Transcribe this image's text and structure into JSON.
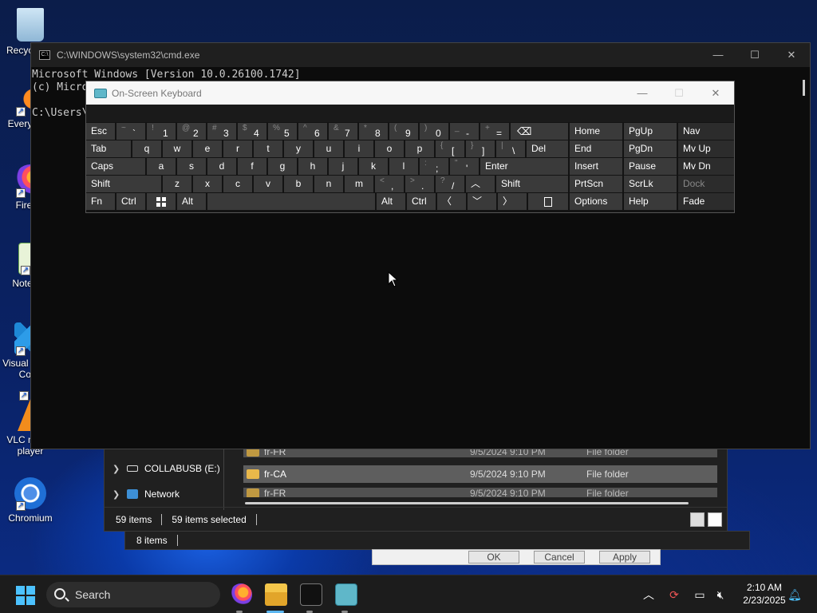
{
  "desktop": {
    "icons": [
      {
        "label": "Recycle Bin"
      },
      {
        "label": "Everything"
      },
      {
        "label": "Firefox"
      },
      {
        "label": "Notepad"
      },
      {
        "label": "Visual Studio Code"
      },
      {
        "label": "VLC media player"
      },
      {
        "label": "Chromium"
      }
    ]
  },
  "explorer": {
    "nav_items": [
      {
        "label": "COLLABUSB (E:)"
      },
      {
        "label": "Network"
      }
    ],
    "rows": [
      {
        "name": "fr-FR",
        "date": "9/5/2024 9:10 PM",
        "type": "File folder"
      },
      {
        "name": "fr-CA",
        "date": "9/5/2024 9:10 PM",
        "type": "File folder"
      },
      {
        "name": "fr-FR",
        "date": "9/5/2024 9:10 PM",
        "type": "File folder"
      }
    ],
    "status_count": "59 items",
    "status_selected": "59 items selected"
  },
  "explorer2": {
    "status_count": "8 items"
  },
  "dialog": {
    "ok": "OK",
    "cancel": "Cancel",
    "apply": "Apply"
  },
  "cmd": {
    "title": "C:\\WINDOWS\\system32\\cmd.exe",
    "line1": "Microsoft Windows [Version 10.0.26100.1742]",
    "line2": "(c) Micro",
    "line3": "C:\\Users\\"
  },
  "osk": {
    "title": "On-Screen Keyboard",
    "row1": {
      "esc": "Esc",
      "k1s": "!",
      "k1": "1",
      "k2s": "@",
      "k2": "2",
      "k3s": "#",
      "k3": "3",
      "k4s": "$",
      "k4": "4",
      "k5s": "%",
      "k5": "5",
      "k6s": "^",
      "k6": "6",
      "k7s": "&",
      "k7": "7",
      "k8s": "*",
      "k8": "8",
      "k9s": "(",
      "k9": "9",
      "k0s": ")",
      "k0": "0",
      "minus_s": "_",
      "minus": "-",
      "eq_s": "+",
      "eq": "=",
      "backtick_s": "~",
      "backtick": "`"
    },
    "row2": {
      "tab": "Tab",
      "q": "q",
      "w": "w",
      "e": "e",
      "r": "r",
      "t": "t",
      "y": "y",
      "u": "u",
      "i": "i",
      "o": "o",
      "p": "p",
      "lb_s": "{",
      "lb": "[",
      "rb_s": "}",
      "rb": "]",
      "bs_s": "|",
      "bs": "\\",
      "del": "Del"
    },
    "row3": {
      "caps": "Caps",
      "a": "a",
      "s": "s",
      "d": "d",
      "f": "f",
      "g": "g",
      "h": "h",
      "j": "j",
      "k": "k",
      "l": "l",
      "semi_s": ":",
      "semi": ";",
      "quote_s": "\"",
      "quote": "'",
      "enter": "Enter"
    },
    "row4": {
      "shift": "Shift",
      "z": "z",
      "x": "x",
      "c": "c",
      "v": "v",
      "b": "b",
      "n": "n",
      "m": "m",
      "comma_s": "<",
      "comma": ",",
      "dot_s": ">",
      "dot": ".",
      "slash_s": "?",
      "slash": "/",
      "shift_r": "Shift"
    },
    "row5": {
      "fn": "Fn",
      "ctrl": "Ctrl",
      "alt": "Alt",
      "alt_r": "Alt",
      "ctrl_r": "Ctrl"
    },
    "nav": [
      [
        "Home",
        "PgUp",
        "Nav"
      ],
      [
        "End",
        "PgDn",
        "Mv Up"
      ],
      [
        "Insert",
        "Pause",
        "Mv Dn"
      ],
      [
        "PrtScn",
        "ScrLk",
        "Dock"
      ],
      [
        "Options",
        "Help",
        "Fade"
      ]
    ]
  },
  "taskbar": {
    "search_placeholder": "Search",
    "time": "2:10 AM",
    "date": "2/23/2025"
  }
}
